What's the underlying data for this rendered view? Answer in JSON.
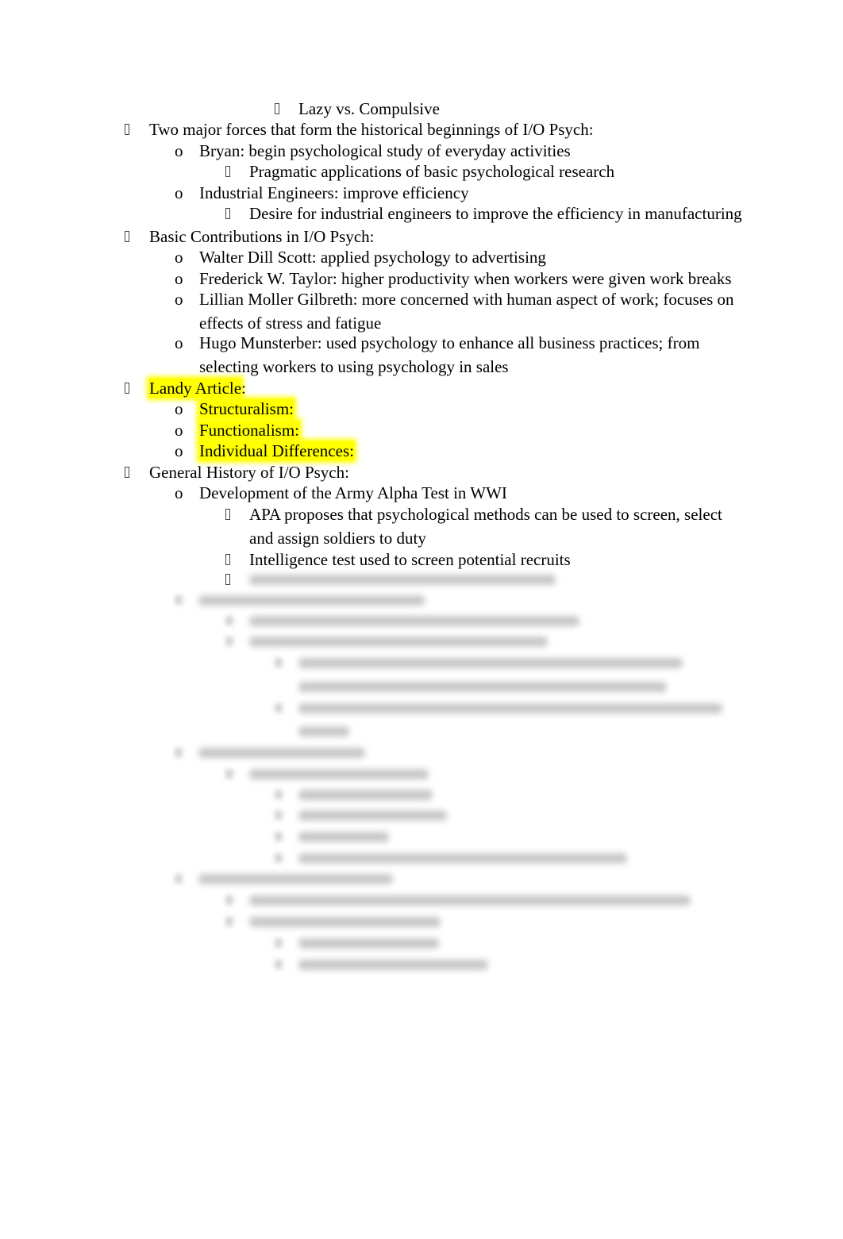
{
  "document": {
    "lines": [
      {
        "level": 4,
        "bullet": "square",
        "text": "Lazy vs. Compulsive"
      },
      {
        "level": 1,
        "bullet": "square",
        "text": "Two major forces that form the historical beginnings of I/O Psych:"
      },
      {
        "level": 2,
        "bullet": "o",
        "text": "Bryan: begin psychological study of everyday activities"
      },
      {
        "level": 3,
        "bullet": "square",
        "text": "Pragmatic applications of basic psychological research"
      },
      {
        "level": 2,
        "bullet": "o",
        "text": "Industrial Engineers: improve efficiency"
      },
      {
        "level": 3,
        "bullet": "square",
        "text": "Desire for industrial engineers to improve the efficiency in manufacturing"
      },
      {
        "level": 1,
        "bullet": "square",
        "text": "Basic Contributions in I/O Psych:"
      },
      {
        "level": 2,
        "bullet": "o",
        "text": "Walter Dill Scott: applied psychology to advertising"
      },
      {
        "level": 2,
        "bullet": "o",
        "text": "Frederick W. Taylor: higher productivity when workers were given work breaks"
      },
      {
        "level": 2,
        "bullet": "o",
        "text": "Lillian Moller Gilbreth: more concerned with human aspect of work; focuses on"
      },
      {
        "level": 2,
        "bullet": "",
        "text": "effects of stress and fatigue"
      },
      {
        "level": 2,
        "bullet": "o",
        "text": "Hugo Munsterber: used psychology to enhance all business practices; from"
      },
      {
        "level": 2,
        "bullet": "",
        "text": "selecting workers to using psychology in sales"
      },
      {
        "level": 1,
        "bullet": "square",
        "text": "Landy Article",
        "suffix": ":",
        "highlight": true
      },
      {
        "level": 2,
        "bullet": "o",
        "text": "Structuralism:",
        "highlight": true
      },
      {
        "level": 2,
        "bullet": "o",
        "text": "Functionalism:",
        "highlight": true
      },
      {
        "level": 2,
        "bullet": "o",
        "text": "Individual Differences:",
        "highlight": true
      },
      {
        "level": 1,
        "bullet": "square",
        "text": "General History of I/O Psych:"
      },
      {
        "level": 2,
        "bullet": "o",
        "text": "Development of the Army Alpha Test in WWI"
      },
      {
        "level": 3,
        "bullet": "square",
        "text": "APA proposes that psychological methods can be used to screen, select"
      },
      {
        "level": 3,
        "bullet": "",
        "text": "and assign soldiers to duty"
      },
      {
        "level": 3,
        "bullet": "square",
        "text": "Intelligence test used to screen potential recruits"
      },
      {
        "level": 3,
        "bullet": "square",
        "text": ""
      }
    ],
    "highlight_color": "#ffff00"
  }
}
